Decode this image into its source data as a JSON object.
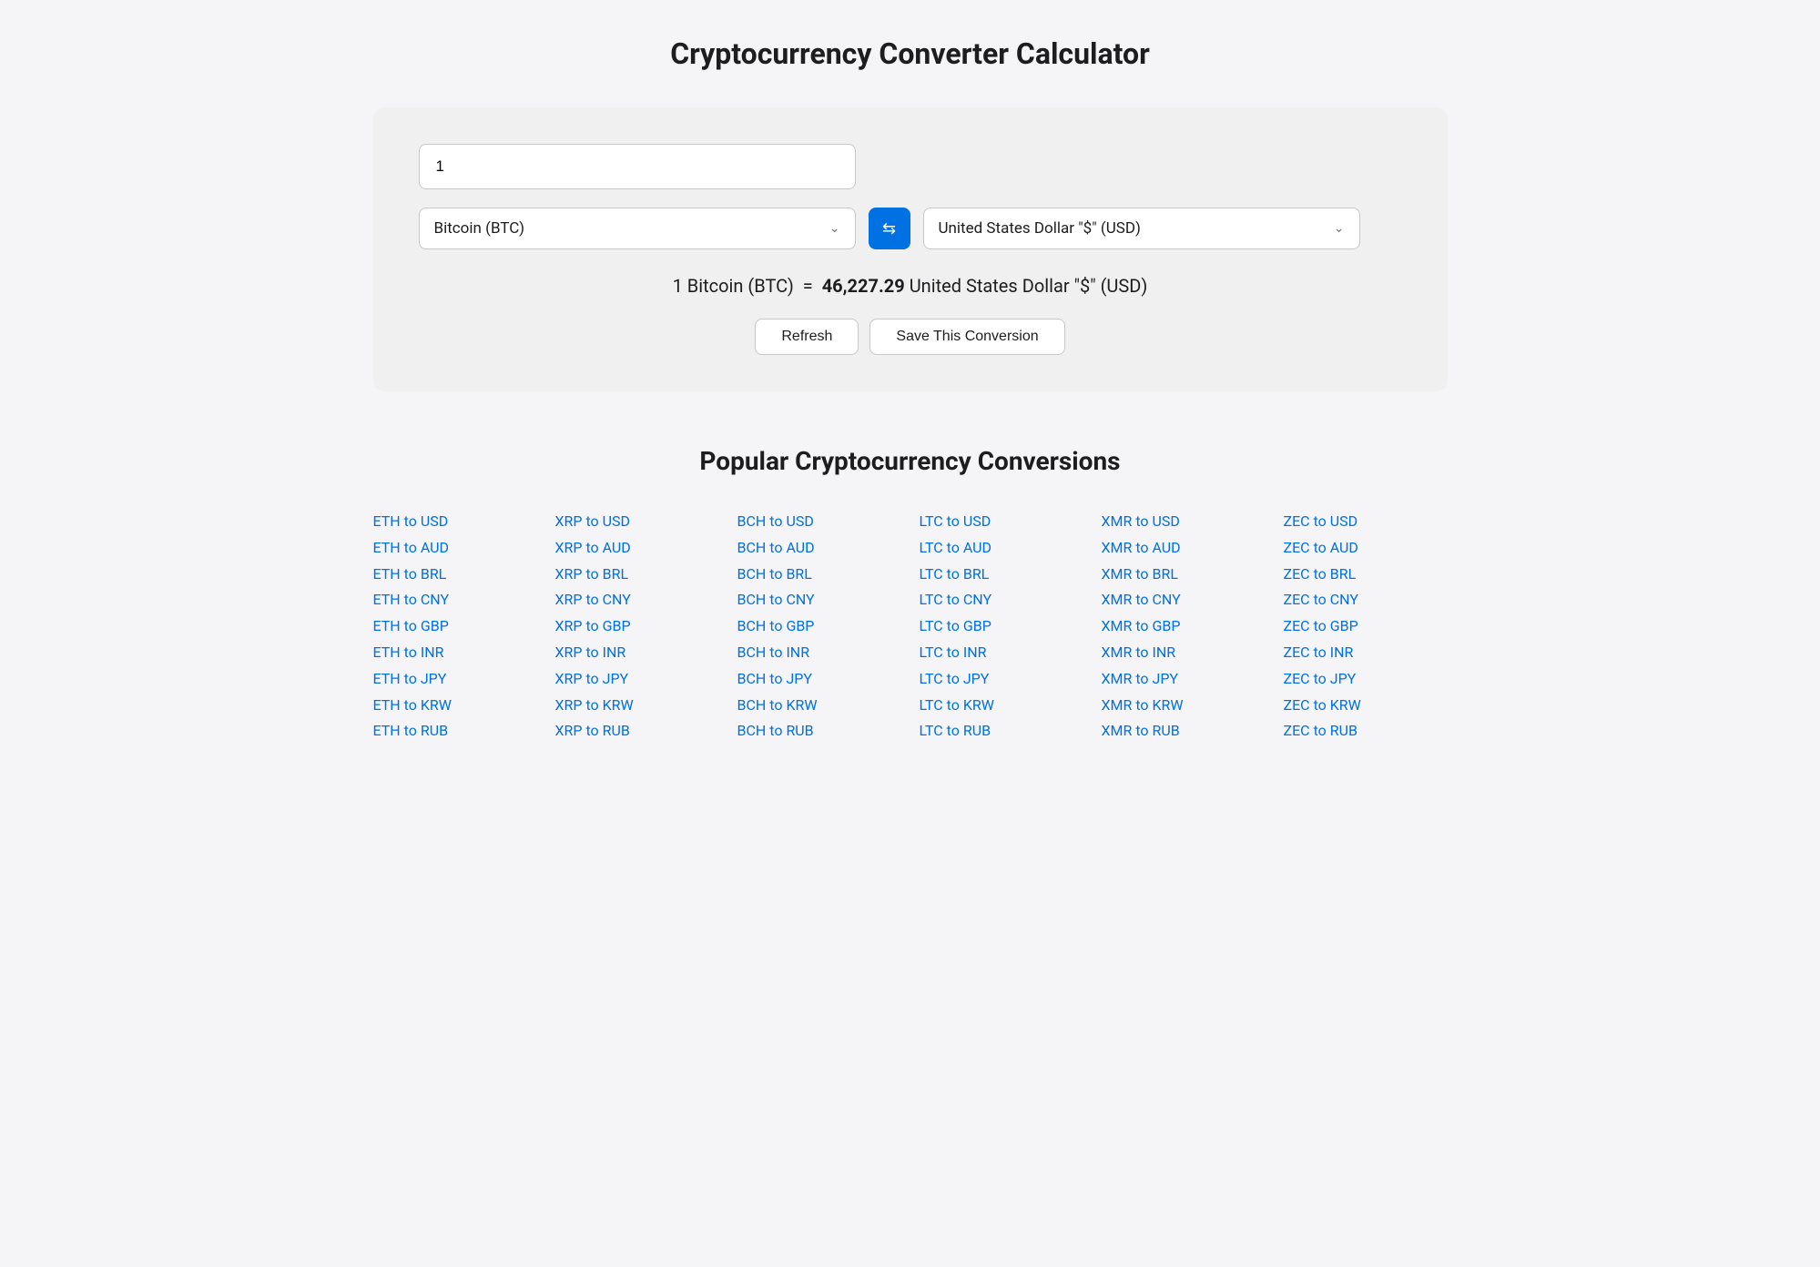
{
  "page": {
    "title": "Cryptocurrency Converter Calculator"
  },
  "converter": {
    "amount_value": "1",
    "from_currency": "Bitcoin (BTC)",
    "to_currency": "United States Dollar \"$\" (USD)",
    "result_text": "1 Bitcoin (BTC)",
    "equals": "=",
    "result_amount": "46,227.29",
    "result_currency": "United States Dollar \"$\" (USD)",
    "refresh_label": "Refresh",
    "save_label": "Save This Conversion",
    "swap_icon": "⇄"
  },
  "popular": {
    "section_title": "Popular Cryptocurrency Conversions",
    "columns": [
      {
        "id": "eth",
        "links": [
          "ETH to USD",
          "ETH to AUD",
          "ETH to BRL",
          "ETH to CNY",
          "ETH to GBP",
          "ETH to INR",
          "ETH to JPY",
          "ETH to KRW",
          "ETH to RUB"
        ]
      },
      {
        "id": "xrp",
        "links": [
          "XRP to USD",
          "XRP to AUD",
          "XRP to BRL",
          "XRP to CNY",
          "XRP to GBP",
          "XRP to INR",
          "XRP to JPY",
          "XRP to KRW",
          "XRP to RUB"
        ]
      },
      {
        "id": "bch",
        "links": [
          "BCH to USD",
          "BCH to AUD",
          "BCH to BRL",
          "BCH to CNY",
          "BCH to GBP",
          "BCH to INR",
          "BCH to JPY",
          "BCH to KRW",
          "BCH to RUB"
        ]
      },
      {
        "id": "ltc",
        "links": [
          "LTC to USD",
          "LTC to AUD",
          "LTC to BRL",
          "LTC to CNY",
          "LTC to GBP",
          "LTC to INR",
          "LTC to JPY",
          "LTC to KRW",
          "LTC to RUB"
        ]
      },
      {
        "id": "xmr",
        "links": [
          "XMR to USD",
          "XMR to AUD",
          "XMR to BRL",
          "XMR to CNY",
          "XMR to GBP",
          "XMR to INR",
          "XMR to JPY",
          "XMR to KRW",
          "XMR to RUB"
        ]
      },
      {
        "id": "zec",
        "links": [
          "ZEC to USD",
          "ZEC to AUD",
          "ZEC to BRL",
          "ZEC to CNY",
          "ZEC to GBP",
          "ZEC to INR",
          "ZEC to JPY",
          "ZEC to KRW",
          "ZEC to RUB"
        ]
      }
    ]
  }
}
